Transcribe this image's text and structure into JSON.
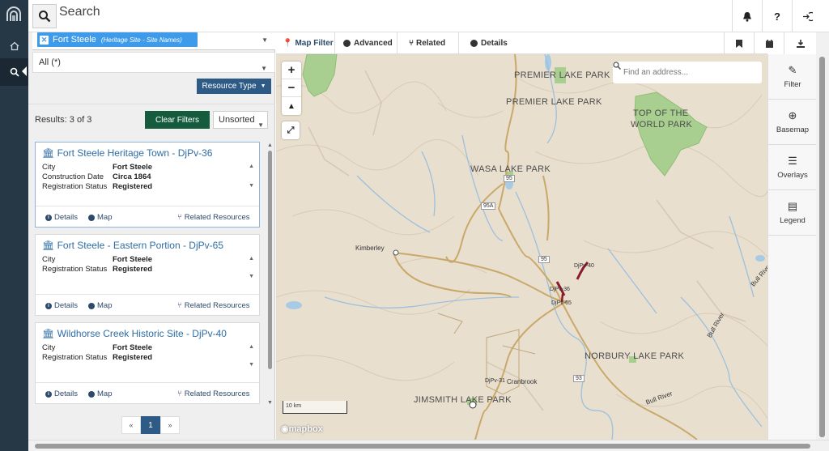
{
  "header": {
    "search_title": "Search"
  },
  "filter": {
    "chip_name": "Fort Steele",
    "chip_sub": "(Heritage Site - Site Names)",
    "all_value": "All (*)",
    "resource_type_label": "Resource Type"
  },
  "results": {
    "count_text": "Results: 3 of 3",
    "clear_label": "Clear Filters",
    "sort_value": "Unsorted",
    "cards": [
      {
        "title": "Fort Steele Heritage Town - DjPv-36",
        "fields": [
          {
            "k": "City",
            "v": "Fort Steele"
          },
          {
            "k": "Construction Date",
            "v": "Circa 1864"
          },
          {
            "k": "Registration Status",
            "v": "Registered"
          }
        ]
      },
      {
        "title": "Fort Steele - Eastern Portion - DjPv-65",
        "fields": [
          {
            "k": "City",
            "v": "Fort Steele"
          },
          {
            "k": "Registration Status",
            "v": "Registered"
          }
        ]
      },
      {
        "title": "Wildhorse Creek Historic Site - DjPv-40",
        "fields": [
          {
            "k": "City",
            "v": "Fort Steele"
          },
          {
            "k": "Registration Status",
            "v": "Registered"
          }
        ]
      }
    ],
    "actions": {
      "details": "Details",
      "map": "Map",
      "related": "Related Resources"
    },
    "pager": {
      "prev": "«",
      "current": "1",
      "next": "»"
    }
  },
  "map_tabs": {
    "map_filter": "Map Filter",
    "advanced": "Advanced",
    "related": "Related",
    "details": "Details"
  },
  "map": {
    "address_placeholder": "Find an address...",
    "scale_label": "10 km",
    "attribution": "mapbox",
    "labels": {
      "premier1": "PREMIER LAKE PARK",
      "premier2": "PREMIER LAKE PARK",
      "top_world_1": "TOP OF THE",
      "top_world_2": "WORLD PARK",
      "wasa": "WASA LAKE PARK",
      "norbury": "NORBURY LAKE PARK",
      "jimsmith": "JIMSMITH LAKE PARK",
      "kimberley": "Kimberley",
      "cranbrook": "Cranbrook",
      "bull_river_1": "Bull River",
      "bull_river_2": "Bull River",
      "bull_river_3": "Bull River",
      "djpv40": "DjPv-40",
      "djpv36": "DjPv-36",
      "djpv65": "DjPv-65",
      "djpv31": "DjPv-31",
      "hwy95": "95",
      "hwy95a": "95A",
      "hwy93": "93",
      "hwy95b": "95",
      "hwy93b": "93"
    }
  },
  "sidebar": {
    "filter": "Filter",
    "basemap": "Basemap",
    "overlays": "Overlays",
    "legend": "Legend"
  },
  "icons": {
    "help": "?",
    "pager_prev": "«",
    "pager_next": "»"
  }
}
